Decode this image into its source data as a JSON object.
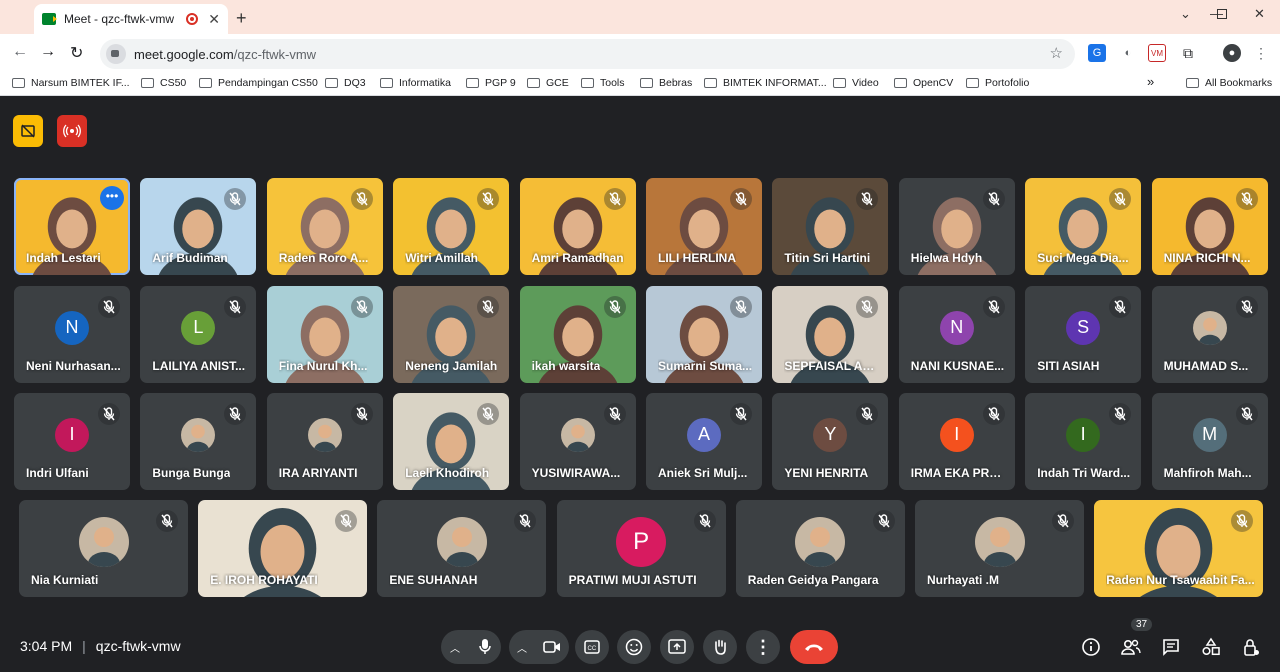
{
  "browser": {
    "tab_title": "Meet - qzc-ftwk-vmw",
    "url_host": "meet.google.com",
    "url_path": "/qzc-ftwk-vmw",
    "bookmarks": [
      "Narsum BIMTEK IF...",
      "CS50",
      "Pendampingan CS50",
      "DQ3",
      "Informatika",
      "PGP 9",
      "GCE",
      "Tools",
      "Bebras",
      "BIMTEK INFORMAT...",
      "Video",
      "OpenCV",
      "Portofolio"
    ],
    "bookmarks_overflow": "»",
    "all_bookmarks": "All Bookmarks"
  },
  "meeting": {
    "time": "3:04 PM",
    "code": "qzc-ftwk-vmw",
    "participant_count": "37",
    "participants_row1": [
      {
        "name": "Indah Lestari",
        "bg": "#f5b92e"
      },
      {
        "name": "Arif Budiman",
        "bg": "#b8d6ec"
      },
      {
        "name": "Raden Roro A...",
        "bg": "#f6c33a"
      },
      {
        "name": "Witri Amillah",
        "bg": "#f3c130"
      },
      {
        "name": "Amri Ramadhan",
        "bg": "#f5bd36"
      },
      {
        "name": "LILI HERLINA",
        "bg": "#b8763a"
      },
      {
        "name": "Titin Sri Hartini",
        "bg": "#5b4a3a"
      },
      {
        "name": "Hielwa Hdyh",
        "bg": "#3c4043"
      },
      {
        "name": "Suci Mega Dia...",
        "bg": "#f4c03a"
      },
      {
        "name": "NINA RICHI N...",
        "bg": "#f5b92e"
      }
    ],
    "participants_row2": [
      {
        "name": "Neni Nurhasan...",
        "initial": "N",
        "color": "#1565c0"
      },
      {
        "name": "LAILIYA ANIST...",
        "initial": "L",
        "color": "#689f38"
      },
      {
        "name": "Fina Nurul Kh...",
        "bg": "#a9cfd6"
      },
      {
        "name": "Neneng Jamilah",
        "bg": "#7a6a5c"
      },
      {
        "name": "ikah warsita",
        "bg": "#5d9b5a"
      },
      {
        "name": "Sumarni Suma...",
        "bg": "#b7c8d6"
      },
      {
        "name": "SEPFAISAL AM...",
        "bg": "#d7cfc4"
      },
      {
        "name": "NANI KUSNAE...",
        "initial": "N",
        "color": "#8e44ad"
      },
      {
        "name": "SITI ASIAH",
        "initial": "S",
        "color": "#5e35b1"
      },
      {
        "name": "MUHAMAD S...",
        "photo": true
      }
    ],
    "participants_row3": [
      {
        "name": "Indri Ulfani",
        "initial": "I",
        "color": "#c2185b"
      },
      {
        "name": "Bunga Bunga",
        "photo": true
      },
      {
        "name": "IRA ARIYANTI",
        "photo": true
      },
      {
        "name": "Laeli Khodiroh",
        "bg": "#d9d3c5"
      },
      {
        "name": "YUSIWIRAWA...",
        "photo": true
      },
      {
        "name": "Aniek Sri Mulj...",
        "initial": "A",
        "color": "#5c6bc0"
      },
      {
        "name": "YENI HENRITA",
        "initial": "Y",
        "color": "#6d4c41"
      },
      {
        "name": "IRMA EKA PRA...",
        "initial": "I",
        "color": "#f4511e"
      },
      {
        "name": "Indah Tri Ward...",
        "initial": "I",
        "color": "#33691e"
      },
      {
        "name": "Mahfiroh Mah...",
        "initial": "M",
        "color": "#546e7a"
      }
    ],
    "participants_row4": [
      {
        "name": "Nia Kurniati",
        "photo": true
      },
      {
        "name": "E. IROH ROHAYATI",
        "bg": "#e9e1d2"
      },
      {
        "name": "ENE SUHANAH",
        "photo": true
      },
      {
        "name": "PRATIWI MUJI ASTUTI",
        "initial": "P",
        "color": "#d81b60"
      },
      {
        "name": "Raden Geidya Pangara",
        "photo": true
      },
      {
        "name": "Nurhayati .M",
        "photo": true
      },
      {
        "name": "Raden Nur Tsawaabit Fa...",
        "bg": "#f6c53f"
      }
    ]
  }
}
